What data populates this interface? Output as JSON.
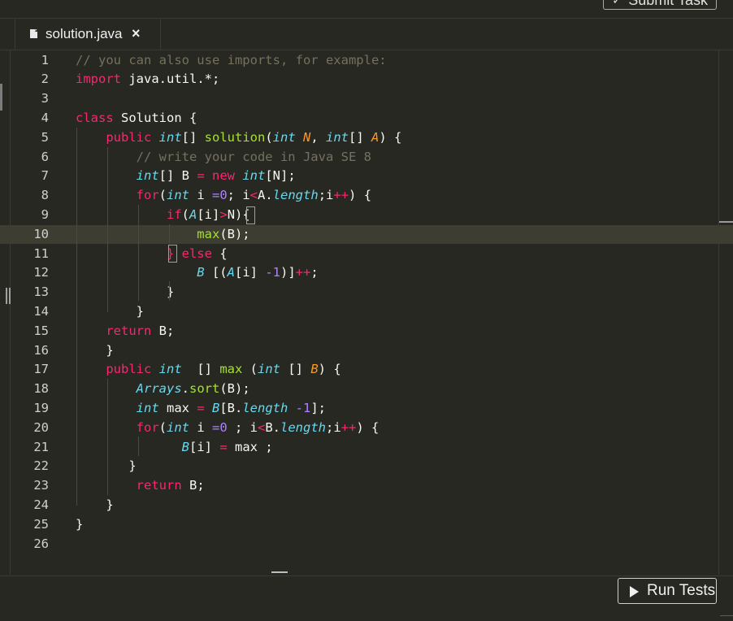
{
  "toolbar": {
    "submit_label": "Submit Task"
  },
  "tab": {
    "filename": "solution.java",
    "close_glyph": "×",
    "file_icon": "file-icon"
  },
  "editor": {
    "language": "Java",
    "active_line": 10,
    "lines": [
      [
        [
          "// you can also use imports, for example:",
          "#75715e"
        ]
      ],
      [
        [
          "import",
          "#f92672"
        ],
        [
          " java.util.*;",
          "#f8f8f2"
        ]
      ],
      [
        [
          "",
          "#f8f8f2"
        ]
      ],
      [
        [
          "class",
          "#f92672"
        ],
        [
          " Solution {",
          "#f8f8f2"
        ]
      ],
      [
        [
          "    public",
          "#f92672"
        ],
        [
          " int",
          "#66d9ef"
        ],
        [
          "[] ",
          "#f8f8f2"
        ],
        [
          "solution",
          "#a6e22e"
        ],
        [
          "(",
          "#f8f8f2"
        ],
        [
          "int",
          "#66d9ef"
        ],
        [
          " N",
          "#fd971f"
        ],
        [
          ", ",
          "#f8f8f2"
        ],
        [
          "int",
          "#66d9ef"
        ],
        [
          "[] ",
          "#f8f8f2"
        ],
        [
          "A",
          "#fd971f"
        ],
        [
          ") {",
          "#f8f8f2"
        ]
      ],
      [
        [
          "        // write your code in Java SE 8",
          "#75715e"
        ]
      ],
      [
        [
          "        int",
          "#66d9ef"
        ],
        [
          "[] B ",
          "#f8f8f2"
        ],
        [
          "=",
          "#f92672"
        ],
        [
          " new",
          "#f92672"
        ],
        [
          " int",
          "#66d9ef"
        ],
        [
          "[N];",
          "#f8f8f2"
        ]
      ],
      [
        [
          "        for",
          "#f92672"
        ],
        [
          "(",
          "#f8f8f2"
        ],
        [
          "int",
          "#66d9ef"
        ],
        [
          " i ",
          "#f8f8f2"
        ],
        [
          "=0",
          "#ae81ff"
        ],
        [
          "; i",
          "#f8f8f2"
        ],
        [
          "<",
          "#f92672"
        ],
        [
          "A.",
          "#f8f8f2"
        ],
        [
          "length",
          "#66d9ef"
        ],
        [
          ";i",
          "#f8f8f2"
        ],
        [
          "++",
          "#f92672"
        ],
        [
          ") {",
          "#f8f8f2"
        ]
      ],
      [
        [
          "            if",
          "#f92672"
        ],
        [
          "(",
          "#f8f8f2"
        ],
        [
          "A",
          "#66d9ef"
        ],
        [
          "[i]",
          "#f8f8f2"
        ],
        [
          ">",
          "#f92672"
        ],
        [
          "N){",
          "#f8f8f2"
        ]
      ],
      [
        [
          "                max",
          "#a6e22e"
        ],
        [
          "(B);",
          "#f8f8f2"
        ]
      ],
      [
        [
          "            } else",
          "#f92672"
        ],
        [
          " {",
          "#f8f8f2"
        ]
      ],
      [
        [
          "                B",
          "#66d9ef"
        ],
        [
          " [(",
          "#f8f8f2"
        ],
        [
          "A",
          "#66d9ef"
        ],
        [
          "[i] ",
          "#f8f8f2"
        ],
        [
          "-1",
          "#ae81ff"
        ],
        [
          ")]",
          "#f8f8f2"
        ],
        [
          "++",
          "#f92672"
        ],
        [
          ";",
          "#f8f8f2"
        ]
      ],
      [
        [
          "            }",
          "#f8f8f2"
        ]
      ],
      [
        [
          "        }",
          "#f8f8f2"
        ]
      ],
      [
        [
          "    return",
          "#f92672"
        ],
        [
          " B;",
          "#f8f8f2"
        ]
      ],
      [
        [
          "    }",
          "#f8f8f2"
        ]
      ],
      [
        [
          "    public",
          "#f92672"
        ],
        [
          " int",
          "#66d9ef"
        ],
        [
          "  [] ",
          "#f8f8f2"
        ],
        [
          "max",
          "#a6e22e"
        ],
        [
          " (",
          "#f8f8f2"
        ],
        [
          "int",
          "#66d9ef"
        ],
        [
          " [] ",
          "#f8f8f2"
        ],
        [
          "B",
          "#fd971f"
        ],
        [
          ") {",
          "#f8f8f2"
        ]
      ],
      [
        [
          "        Arrays",
          "#66d9ef"
        ],
        [
          ".",
          "#f8f8f2"
        ],
        [
          "sort",
          "#a6e22e"
        ],
        [
          "(B);",
          "#f8f8f2"
        ]
      ],
      [
        [
          "        int",
          "#66d9ef"
        ],
        [
          " max ",
          "#f8f8f2"
        ],
        [
          "=",
          "#f92672"
        ],
        [
          " B",
          "#66d9ef"
        ],
        [
          "[B.",
          "#f8f8f2"
        ],
        [
          "length",
          "#66d9ef"
        ],
        [
          " -1",
          "#ae81ff"
        ],
        [
          "];",
          "#f8f8f2"
        ]
      ],
      [
        [
          "        for",
          "#f92672"
        ],
        [
          "(",
          "#f8f8f2"
        ],
        [
          "int",
          "#66d9ef"
        ],
        [
          " i ",
          "#f8f8f2"
        ],
        [
          "=0",
          "#ae81ff"
        ],
        [
          " ; i",
          "#f8f8f2"
        ],
        [
          "<",
          "#f92672"
        ],
        [
          "B.",
          "#f8f8f2"
        ],
        [
          "length",
          "#66d9ef"
        ],
        [
          ";i",
          "#f8f8f2"
        ],
        [
          "++",
          "#f92672"
        ],
        [
          ") {",
          "#f8f8f2"
        ]
      ],
      [
        [
          "              B",
          "#66d9ef"
        ],
        [
          "[i] ",
          "#f8f8f2"
        ],
        [
          "=",
          "#f92672"
        ],
        [
          " max ;",
          "#f8f8f2"
        ]
      ],
      [
        [
          "       }",
          "#f8f8f2"
        ]
      ],
      [
        [
          "        return",
          "#f92672"
        ],
        [
          " B;",
          "#f8f8f2"
        ]
      ],
      [
        [
          "    }",
          "#f8f8f2"
        ]
      ],
      [
        [
          "}",
          "#f8f8f2"
        ]
      ],
      [
        [
          "",
          "#f8f8f2"
        ]
      ]
    ]
  },
  "actions": {
    "run_label": "Run Tests",
    "run_icon": "play-icon"
  },
  "colors": {
    "background": "#272822",
    "active_line": "#3e3d32",
    "keyword": "#f92672",
    "type": "#66d9ef",
    "function": "#a6e22e",
    "parameter": "#fd971f",
    "number": "#ae81ff",
    "comment": "#75715e",
    "text": "#f8f8f2"
  }
}
